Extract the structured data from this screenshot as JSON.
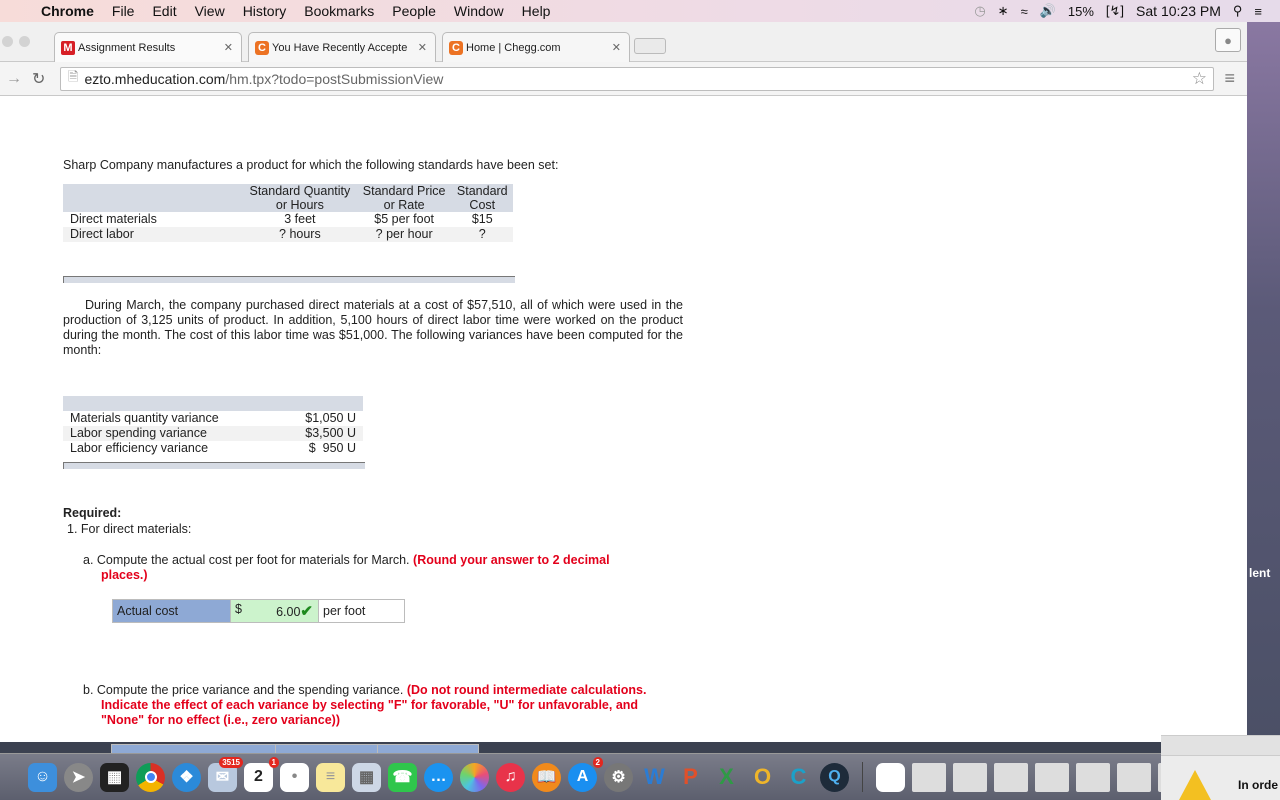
{
  "menubar": {
    "app": "Chrome",
    "items": [
      "File",
      "Edit",
      "View",
      "History",
      "Bookmarks",
      "People",
      "Window",
      "Help"
    ],
    "status": {
      "battery": "15%",
      "clock": "Sat 10:23 PM"
    }
  },
  "tabs": [
    {
      "title": "Assignment Results",
      "favicon": "M"
    },
    {
      "title": "You Have Recently Accepte",
      "favicon": "C"
    },
    {
      "title": "Home | Chegg.com",
      "favicon": "C"
    }
  ],
  "address": {
    "host": "ezto.mheducation.com",
    "path": "/hm.tpx?todo=postSubmissionView"
  },
  "content": {
    "intro": "Sharp Company manufactures a product for which the following standards have been set:",
    "standards": {
      "headers": [
        [
          "",
          ""
        ],
        [
          "Standard Quantity",
          "or Hours"
        ],
        [
          "Standard Price",
          "or Rate"
        ],
        [
          "Standard",
          "Cost"
        ]
      ],
      "rows": [
        [
          "Direct materials",
          "3 feet",
          "$5 per foot",
          "$15"
        ],
        [
          "Direct labor",
          "? hours",
          "? per hour",
          "?"
        ]
      ]
    },
    "paragraph": "During March, the company purchased direct materials at a cost of $57,510, all of which were used in the production of 3,125 units of product. In addition, 5,100 hours of direct labor time were worked on the product during the month. The cost of this labor time was $51,000. The following variances have been computed for the month:",
    "variances": [
      [
        "Materials quantity variance",
        "$1,050 U"
      ],
      [
        "Labor spending variance",
        "$3,500 U"
      ],
      [
        "Labor efficiency variance",
        "$  950 U"
      ]
    ],
    "required_label": "Required:",
    "required_1": "1. For direct materials:",
    "question_a": {
      "text": "a. Compute the actual cost per foot for materials for March.",
      "note": "(Round your answer to 2 decimal places.)"
    },
    "answer_a": {
      "label": "Actual cost",
      "currency": "$",
      "value": "6.00",
      "unit": "per foot"
    },
    "question_b": {
      "text": "b. Compute the price variance and the spending variance.",
      "note": "(Do not round intermediate calculations. Indicate the effect of each variance by selecting \"F\" for favorable, \"U\" for unfavorable, and \"None\" for no effect (i.e., zero variance))"
    }
  },
  "desktop": {
    "partial_label": "lent"
  },
  "dock": {
    "mail_badge": "3515",
    "calendar_day": "2",
    "calendar_badge": "1",
    "appstore_badge": "2"
  },
  "alert": {
    "text": "In orde"
  }
}
